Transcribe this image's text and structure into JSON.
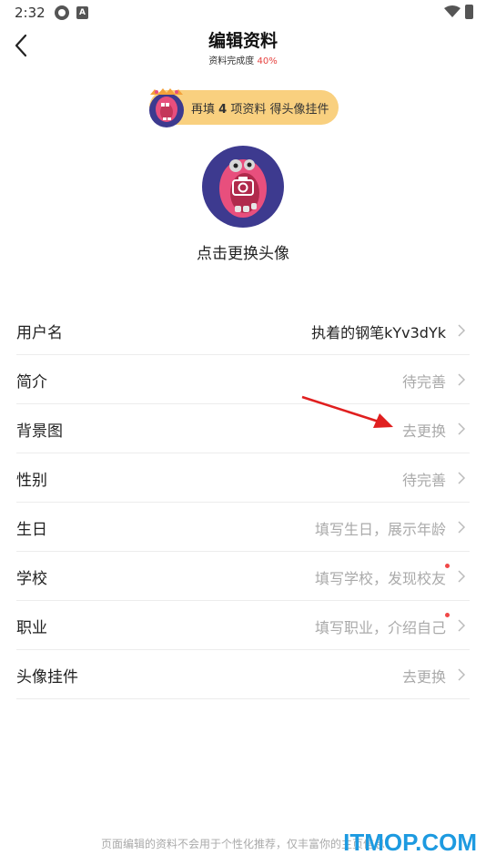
{
  "status_bar": {
    "time": "2:32",
    "icons": [
      "sync-icon",
      "a-app-icon",
      "wifi-icon",
      "battery-icon"
    ]
  },
  "header": {
    "back_icon": "chevron-left-icon",
    "title": "编辑资料",
    "completion_label": "资料完成度",
    "completion_value": "40%"
  },
  "promo": {
    "prefix": "再填",
    "count": "4",
    "suffix": "项资料 得头像挂件"
  },
  "avatar": {
    "caption": "点击更换头像",
    "icon": "camera-icon"
  },
  "rows": [
    {
      "label": "用户名",
      "value": "执着的钢笔kYv3dYk",
      "highlight": true,
      "dot": false
    },
    {
      "label": "简介",
      "value": "待完善",
      "highlight": false,
      "dot": false
    },
    {
      "label": "背景图",
      "value": "去更换",
      "highlight": false,
      "dot": false
    },
    {
      "label": "性别",
      "value": "待完善",
      "highlight": false,
      "dot": false
    },
    {
      "label": "生日",
      "value": "填写生日，展示年龄",
      "highlight": false,
      "dot": false
    },
    {
      "label": "学校",
      "value": "填写学校，发现校友",
      "highlight": false,
      "dot": true
    },
    {
      "label": "职业",
      "value": "填写职业，介绍自己",
      "highlight": false,
      "dot": true
    },
    {
      "label": "头像挂件",
      "value": "去更换",
      "highlight": false,
      "dot": false
    }
  ],
  "colors": {
    "accent_red": "#e64340",
    "promo_bg": "#f9d07f",
    "avatar_bg": "#3d3a8f",
    "watermark": "#1d9ae0"
  },
  "footer": {
    "note": "页面编辑的资料不会用于个性化推荐，仅丰富你的主页信息"
  },
  "watermark": "ITMOP.COM"
}
